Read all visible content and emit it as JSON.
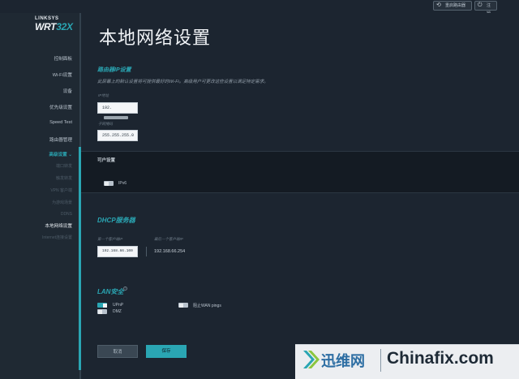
{
  "topbar": {
    "restart_label": "重启路由器",
    "exit_label": "注销"
  },
  "logo": {
    "brand": "LINKSYS",
    "model_prefix": "WRT",
    "model_suffix": "32X"
  },
  "sidebar": {
    "items": [
      {
        "label": "控制面板"
      },
      {
        "label": "Wi-Fi设置"
      },
      {
        "label": "设备"
      },
      {
        "label": "优先级设置"
      },
      {
        "label": "Speed Test"
      },
      {
        "label": "路由器管理"
      },
      {
        "label": "高级设置 ⌄"
      },
      {
        "label": "端口转发"
      },
      {
        "label": "触发转发"
      },
      {
        "label": "VPN 客户端"
      },
      {
        "label": "为游戏场景"
      },
      {
        "label": "DDNS"
      },
      {
        "label": "本地网络设置"
      },
      {
        "label": "Internet连接设置"
      }
    ]
  },
  "page": {
    "title": "本地网络设置",
    "router_section": {
      "title": "路由器IP设置",
      "description": "此屏幕上的默认设置将可提供最好的Wi-Fi。高级用户可更改这些设置以满足特定需求。",
      "ip_label": "IP地址",
      "ip_value": "192.",
      "subnet_label": "子网掩码",
      "subnet_value": "255.255.255.0"
    },
    "band": {
      "title": "可户设置",
      "ipv6_label": "IPv6"
    },
    "dhcp_section": {
      "title": "DHCP服务器",
      "start_label": "第一个客户端IP",
      "start_value": "192.168.66.100",
      "end_label": "最后一个客户端IP",
      "end_value": "192.168.66.254"
    },
    "lan_section": {
      "title": "LAN安全",
      "info": "i",
      "upnp_label": "UPnP",
      "dmz_label": "DMZ",
      "wan_ping_label": "阻止WAN pings"
    },
    "buttons": {
      "cancel_label": "取消",
      "save_label": "保存"
    }
  },
  "watermark": {
    "cn_text": "迅维网",
    "en_text": "Chinafix.com"
  },
  "colors": {
    "accent": "#2aa6b3",
    "background": "#1c2530",
    "sidebar": "#1f2933"
  }
}
